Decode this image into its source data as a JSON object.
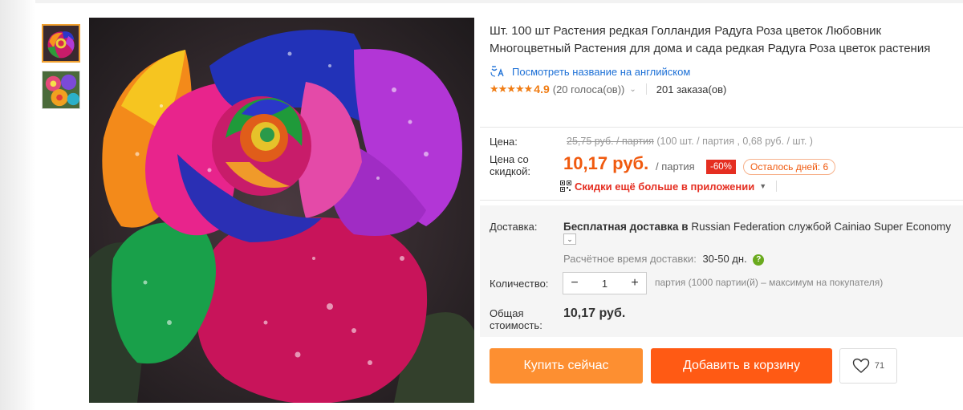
{
  "product": {
    "title": "Шт. 100 шт Растения редкая Голландия Радуга Роза цветок Любовник Многоцветный Растения для дома и сада редкая Радуга Роза цветок растения",
    "translate_link": "Посмотреть название на английском",
    "rating_stars": "★★★★★",
    "rating_value": "4.9",
    "votes": "(20 голоса(ов))",
    "orders": "201 заказа(ов)"
  },
  "price": {
    "price_label": "Цена:",
    "old_price": "25,75 руб. / партия",
    "old_price_detail": "(100 шт. / партия , 0,68 руб. / шт. )",
    "discount_label": "Цена со скидкой:",
    "new_price": "10,17 руб.",
    "per_lot": "/ партия",
    "discount_badge": "-60%",
    "days_left": "Осталось дней: 6",
    "app_discount": "Скидки ещё больше в приложении"
  },
  "delivery": {
    "label": "Доставка:",
    "text_bold": "Бесплатная доставка в",
    "text_rest": "Russian Federation службой Cainiao Super Economy",
    "time_label": "Расчётное время доставки:",
    "time_value": "30-50 дн."
  },
  "quantity": {
    "label": "Количество:",
    "minus": "−",
    "value": "1",
    "plus": "+",
    "note": "партия (1000 партии(й) – максимум на покупателя)"
  },
  "total": {
    "label": "Общая стоимость:",
    "value": "10,17 руб."
  },
  "actions": {
    "buy_now": "Купить сейчас",
    "add_to_cart": "Добавить в корзину",
    "wishlist_count": "71"
  },
  "colors": {
    "accent_orange": "#fd8f31",
    "cart_orange": "#ff5a14",
    "price_red": "#f05a0f",
    "badge_red": "#e52e21",
    "link_blue": "#1b6fd6"
  }
}
